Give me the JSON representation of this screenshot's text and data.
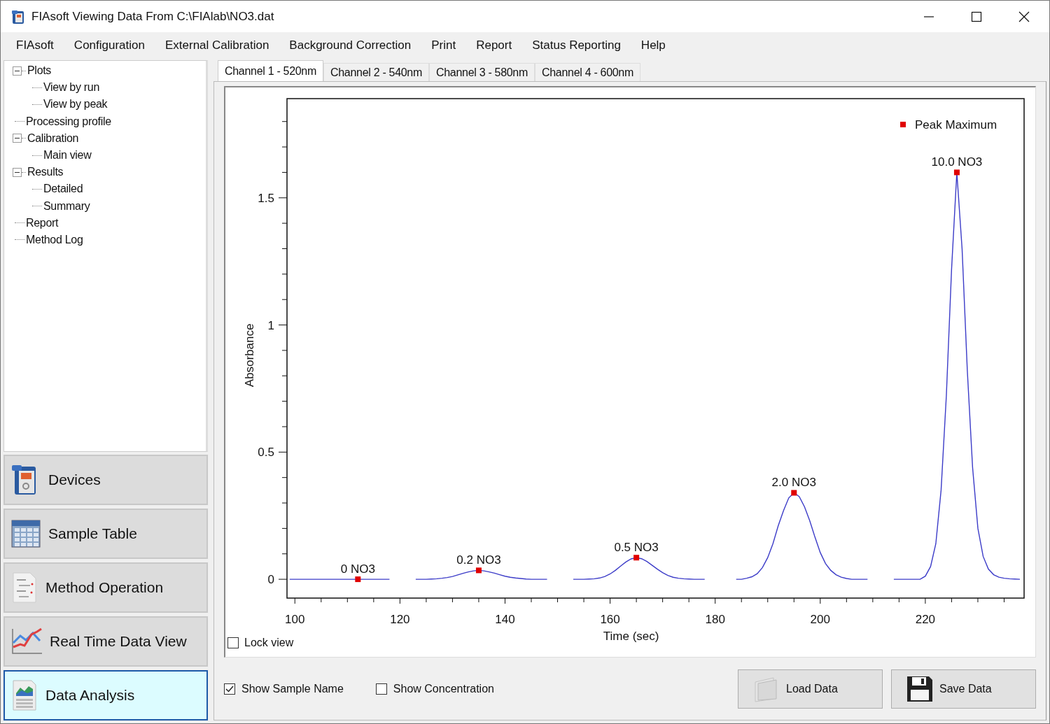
{
  "window": {
    "title": "FIAsoft Viewing Data From C:\\FIAlab\\NO3.dat"
  },
  "menu": [
    "FIAsoft",
    "Configuration",
    "External Calibration",
    "Background Correction",
    "Print",
    "Report",
    "Status Reporting",
    "Help"
  ],
  "tree": [
    {
      "label": "Plots",
      "expanded": true,
      "children": [
        {
          "label": "View by run"
        },
        {
          "label": "View by peak"
        }
      ]
    },
    {
      "label": "Processing profile"
    },
    {
      "label": "Calibration",
      "expanded": true,
      "children": [
        {
          "label": "Main view"
        }
      ]
    },
    {
      "label": "Results",
      "expanded": true,
      "children": [
        {
          "label": "Detailed"
        },
        {
          "label": "Summary"
        }
      ]
    },
    {
      "label": "Report"
    },
    {
      "label": "Method Log"
    }
  ],
  "nav": [
    {
      "label": "Devices",
      "kind": "instrument",
      "selected": false
    },
    {
      "label": "Sample Table",
      "kind": "table",
      "selected": false
    },
    {
      "label": "Method Operation",
      "kind": "document",
      "selected": false
    },
    {
      "label": "Real Time Data View",
      "kind": "chart",
      "selected": false
    },
    {
      "label": "Data Analysis",
      "kind": "report",
      "selected": true
    }
  ],
  "tabs": [
    {
      "label": "Channel 1 - 520nm",
      "selected": true
    },
    {
      "label": "Channel 2 - 540nm",
      "selected": false
    },
    {
      "label": "Channel 3 - 580nm",
      "selected": false
    },
    {
      "label": "Channel 4 - 600nm",
      "selected": false
    }
  ],
  "plot": {
    "chart_data": {
      "type": "line",
      "xlabel": "Time (sec)",
      "ylabel": "Absorbance",
      "xlim": [
        98.5,
        238.8
      ],
      "ylim": [
        -0.074,
        1.89
      ],
      "xticks": [
        100,
        120,
        140,
        160,
        180,
        200,
        220
      ],
      "yticks": [
        0,
        0.5,
        1,
        1.5
      ],
      "x": [
        99,
        100,
        101,
        102,
        103,
        104,
        105,
        106,
        107,
        108,
        109,
        110,
        111,
        112,
        113,
        114,
        115,
        116,
        117,
        118,
        123,
        124,
        125,
        126,
        127,
        128,
        129,
        130,
        131,
        132,
        133,
        134,
        135,
        136,
        137,
        138,
        139,
        140,
        141,
        142,
        143,
        144,
        145,
        146,
        147,
        148,
        153,
        154,
        155,
        156,
        157,
        158,
        159,
        160,
        161,
        162,
        163,
        164,
        165,
        166,
        167,
        168,
        169,
        170,
        171,
        172,
        173,
        174,
        175,
        176,
        177,
        178,
        184,
        185,
        186,
        187,
        188,
        189,
        190,
        191,
        192,
        193,
        194,
        195,
        196,
        197,
        198,
        199,
        200,
        201,
        202,
        203,
        204,
        205,
        206,
        207,
        208,
        209,
        214,
        215,
        216,
        217,
        218,
        219,
        220,
        221,
        222,
        223,
        224,
        225,
        226,
        227,
        228,
        229,
        230,
        231,
        232,
        233,
        234,
        235,
        236,
        237,
        238
      ],
      "series": [
        {
          "color": "#3c3cc8",
          "values": [
            0,
            0,
            0,
            0,
            0,
            0,
            0,
            0,
            0,
            0,
            0,
            0,
            0,
            0,
            0,
            0,
            0,
            0,
            0,
            0,
            0,
            0,
            0,
            0.001,
            0.002,
            0.004,
            0.007,
            0.011,
            0.017,
            0.023,
            0.029,
            0.033,
            0.035,
            0.033,
            0.029,
            0.024,
            0.018,
            0.012,
            0.008,
            0.005,
            0.003,
            0.001,
            0,
            0,
            0,
            0,
            0,
            0,
            0,
            0.001,
            0.002,
            0.005,
            0.011,
            0.021,
            0.035,
            0.052,
            0.068,
            0.08,
            0.085,
            0.081,
            0.07,
            0.055,
            0.04,
            0.026,
            0.015,
            0.008,
            0.004,
            0.002,
            0.001,
            0,
            0,
            0,
            0,
            0,
            0.004,
            0.01,
            0.022,
            0.046,
            0.085,
            0.14,
            0.21,
            0.27,
            0.32,
            0.34,
            0.325,
            0.285,
            0.23,
            0.165,
            0.105,
            0.062,
            0.035,
            0.018,
            0.008,
            0.003,
            0,
            0,
            0,
            0,
            0,
            0,
            0,
            0,
            0,
            0,
            0.012,
            0.05,
            0.14,
            0.35,
            0.72,
            1.22,
            1.6,
            1.3,
            0.82,
            0.44,
            0.2,
            0.09,
            0.04,
            0.018,
            0.008,
            0.004,
            0.002,
            0.001,
            0
          ]
        }
      ],
      "annotations": [
        {
          "x": 112,
          "y": 0,
          "text": "0 NO3"
        },
        {
          "x": 135,
          "y": 0.035,
          "text": "0.2 NO3"
        },
        {
          "x": 165,
          "y": 0.085,
          "text": "0.5 NO3"
        },
        {
          "x": 195,
          "y": 0.34,
          "text": "2.0 NO3"
        },
        {
          "x": 226,
          "y": 1.6,
          "text": "10.0 NO3"
        }
      ]
    },
    "legend": {
      "label": "Peak Maximum",
      "color": "#e00000"
    },
    "lock_view": {
      "label": "Lock view",
      "checked": false
    }
  },
  "options": [
    {
      "label": "Show Sample Name",
      "checked": true
    },
    {
      "label": "Show Concentration",
      "checked": false
    }
  ],
  "buttons": [
    {
      "label": "Load Data",
      "kind": "load"
    },
    {
      "label": "Save Data",
      "kind": "save"
    }
  ]
}
